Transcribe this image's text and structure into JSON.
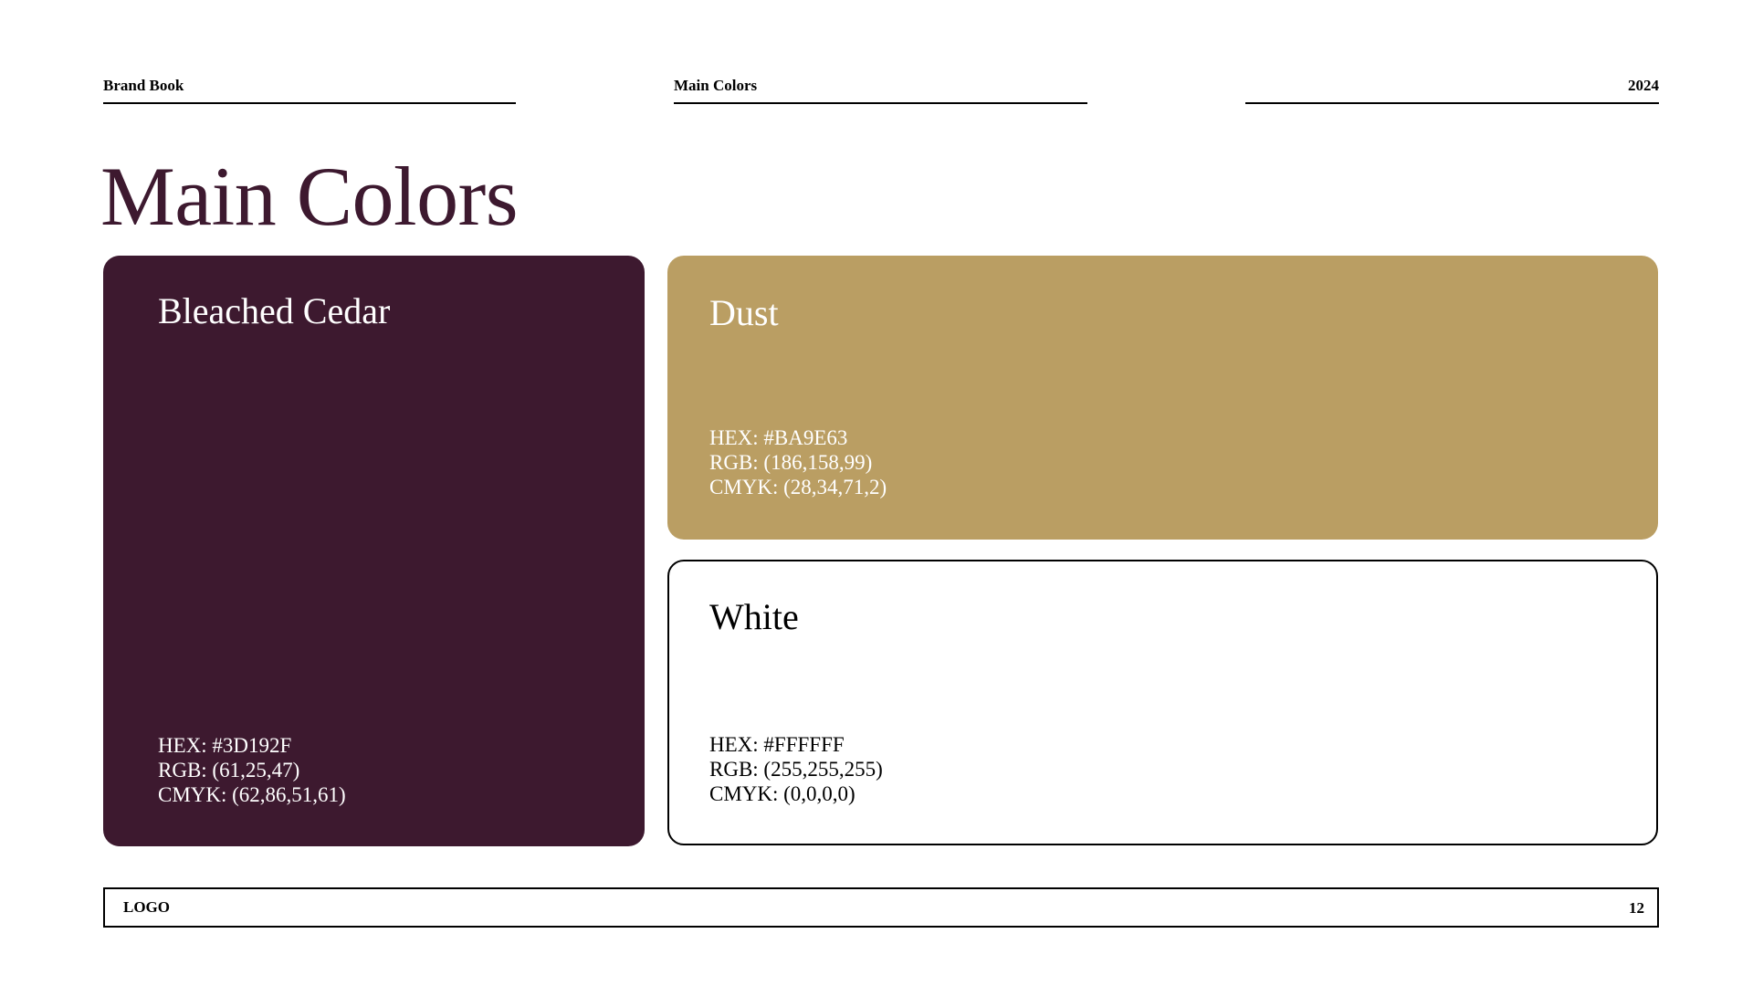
{
  "header": {
    "left": "Brand Book",
    "center": "Main Colors",
    "right": "2024"
  },
  "title": "Main Colors",
  "colors": [
    {
      "name": "Bleached Cedar",
      "hex_label": "HEX: #3D192F",
      "rgb_label": "RGB: (61,25,47)",
      "cmyk_label": "CMYK: (62,86,51,61)",
      "swatch": "#3D192F",
      "text_color": "#FFFFFF"
    },
    {
      "name": "Dust",
      "hex_label": "HEX: #BA9E63",
      "rgb_label": "RGB: (186,158,99)",
      "cmyk_label": "CMYK: (28,34,71,2)",
      "swatch": "#BA9E63",
      "text_color": "#FFFFFF"
    },
    {
      "name": "White",
      "hex_label": "HEX: #FFFFFF",
      "rgb_label": "RGB: (255,255,255)",
      "cmyk_label": "CMYK: (0,0,0,0)",
      "swatch": "#FFFFFF",
      "text_color": "#000000"
    }
  ],
  "footer": {
    "logo": "LOGO",
    "page_number": "12"
  }
}
